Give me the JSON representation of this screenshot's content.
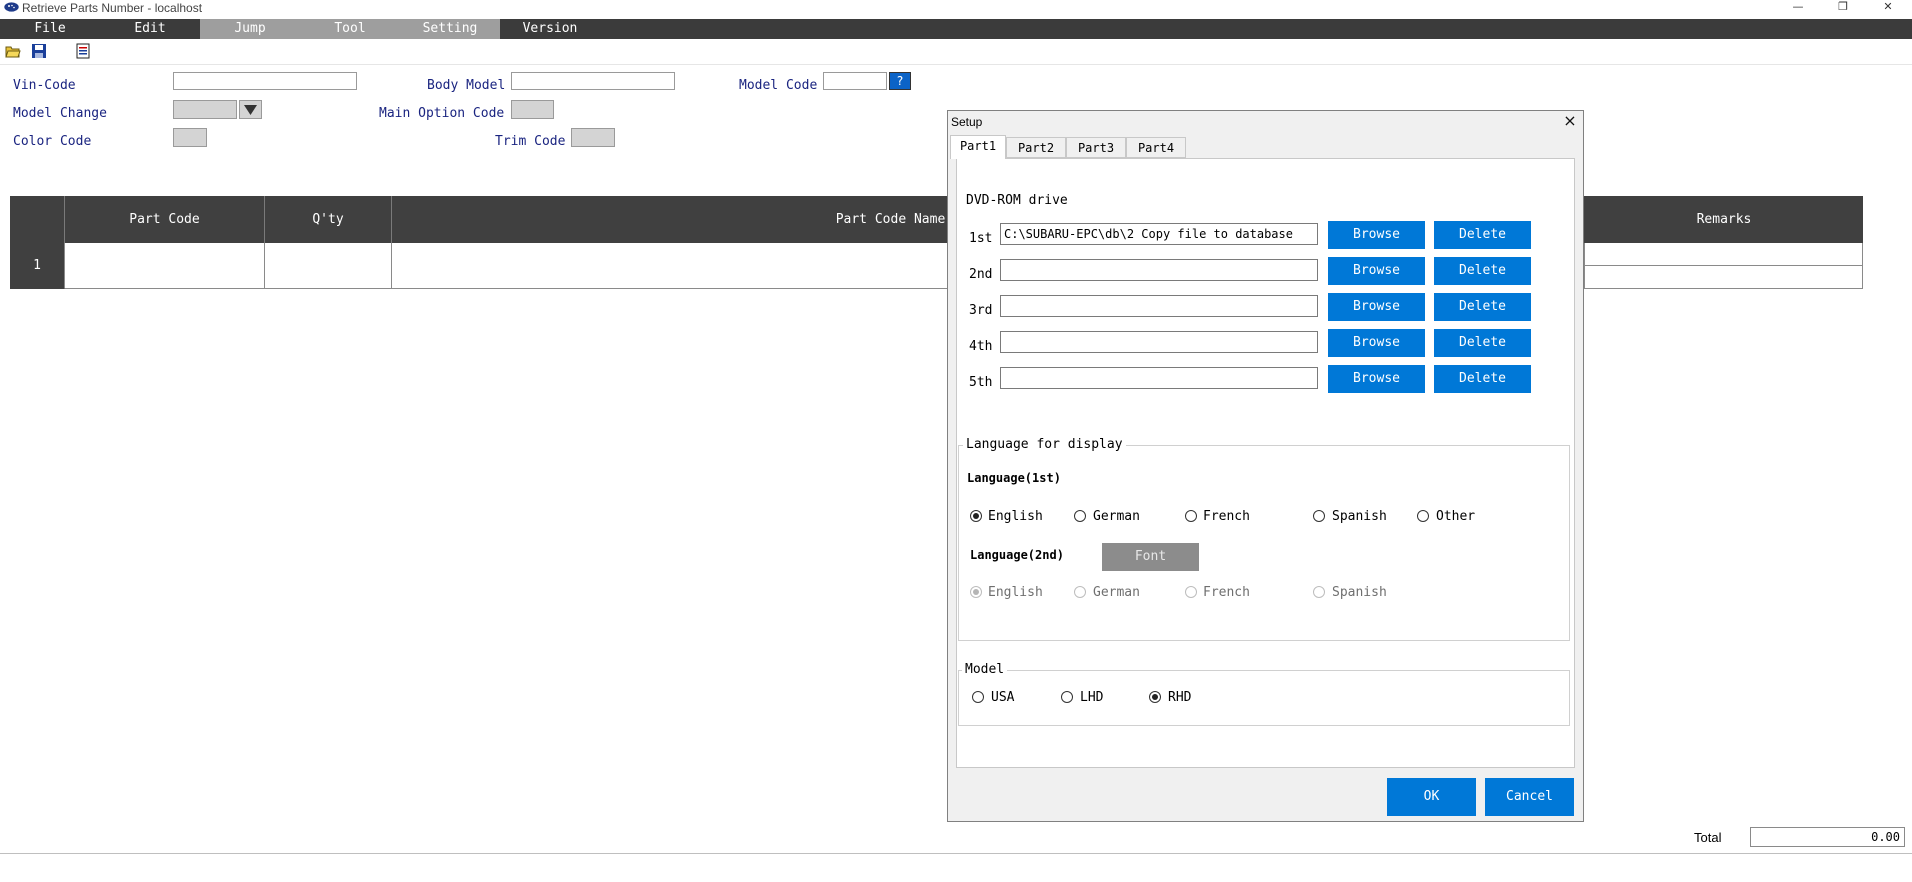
{
  "window": {
    "title": "Retrieve Parts Number - localhost",
    "controls": {
      "minimize": "—",
      "restore": "❐",
      "close": "✕"
    }
  },
  "menu": [
    "File",
    "Edit",
    "Jump",
    "Tool",
    "Setting",
    "Version"
  ],
  "form": {
    "vin_code_label": "Vin-Code",
    "body_model_label": "Body Model",
    "model_code_label": "Model Code",
    "model_code_help": "?",
    "model_change_label": "Model Change",
    "main_option_code_label": "Main Option Code",
    "color_code_label": "Color Code",
    "trim_code_label": "Trim Code"
  },
  "table": {
    "columns": [
      "Part Code",
      "Q'ty",
      "Part Code Name",
      "Remarks"
    ],
    "rows": [
      {
        "num": "1"
      }
    ]
  },
  "footer": {
    "total_label": "Total",
    "total_value": "0.00"
  },
  "dialog": {
    "title": "Setup",
    "close": "×",
    "tabs": [
      "Part1",
      "Part2",
      "Part3",
      "Part4"
    ],
    "dvd_heading": "DVD-ROM drive",
    "drives": [
      {
        "label": "1st",
        "path": "C:\\SUBARU-EPC\\db\\2 Copy file to database"
      },
      {
        "label": "2nd",
        "path": ""
      },
      {
        "label": "3rd",
        "path": ""
      },
      {
        "label": "4th",
        "path": ""
      },
      {
        "label": "5th",
        "path": ""
      }
    ],
    "browse_label": "Browse",
    "delete_label": "Delete",
    "language_group": "Language for display",
    "language1_heading": "Language(1st)",
    "language1_options": [
      "English",
      "German",
      "French",
      "Spanish",
      "Other"
    ],
    "language1_selected": "English",
    "language2_heading": "Language(2nd)",
    "font_button": "Font",
    "language2_options": [
      "English",
      "German",
      "French",
      "Spanish"
    ],
    "language2_selected": "English",
    "model_group": "Model",
    "model_options": [
      "USA",
      "LHD",
      "RHD"
    ],
    "model_selected": "RHD",
    "ok_label": "OK",
    "cancel_label": "Cancel"
  }
}
